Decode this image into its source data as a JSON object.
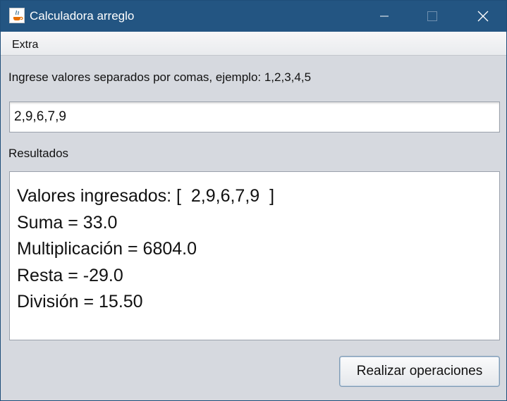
{
  "window": {
    "title": "Calculadora arreglo",
    "controls": {
      "minimize": "minimize-icon",
      "maximize": "maximize-icon",
      "close": "close-icon"
    }
  },
  "menu": {
    "items": [
      {
        "label": "Extra"
      }
    ]
  },
  "form": {
    "instruction": "Ingrese valores separados por comas, ejemplo: 1,2,3,4,5",
    "input_value": "2,9,6,7,9",
    "results_label": "Resultados",
    "results_lines": [
      "Valores ingresados: [  2,9,6,7,9  ]",
      "Suma = 33.0",
      "Multiplicación = 6804.0",
      "Resta = -29.0",
      "División = 15.50"
    ],
    "button_label": "Realizar operaciones"
  },
  "colors": {
    "titlebar": "#235582",
    "window_bg": "#d6d9df",
    "field_border": "#9aa1ab"
  }
}
